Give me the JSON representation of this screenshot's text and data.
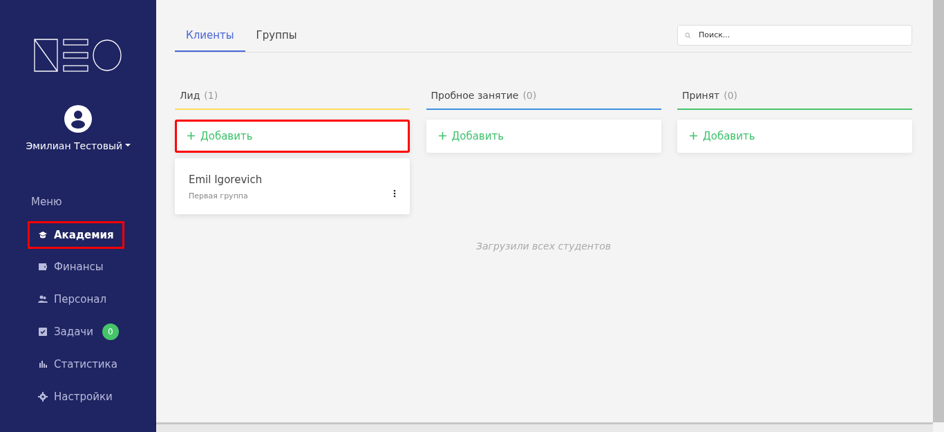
{
  "sidebar": {
    "user": {
      "name": "Эмилиан Тестовый"
    },
    "menu_title": "Меню",
    "items": [
      {
        "label": "Академия",
        "selected": true,
        "highlighted": true
      },
      {
        "label": "Финансы",
        "selected": false,
        "highlighted": false
      },
      {
        "label": "Персонал",
        "selected": false,
        "highlighted": false
      },
      {
        "label": "Задачи",
        "selected": false,
        "highlighted": false,
        "badge": "0"
      },
      {
        "label": "Статистика",
        "selected": false,
        "highlighted": false
      },
      {
        "label": "Настройки",
        "selected": false,
        "highlighted": false
      }
    ]
  },
  "tabs": [
    {
      "label": "Клиенты",
      "selected": true
    },
    {
      "label": "Группы",
      "selected": false
    }
  ],
  "search": {
    "placeholder": "Поиск..."
  },
  "columns": [
    {
      "title": "Лид",
      "count": "(1)",
      "color": "#fcdc5c",
      "add_label": "Добавить",
      "add_highlighted": true,
      "cards": [
        {
          "name": "Emil Igorevich",
          "group": "Первая группа"
        }
      ]
    },
    {
      "title": "Пробное занятие",
      "count": "(0)",
      "color": "#3d8fe0",
      "add_label": "Добавить",
      "add_highlighted": false
    },
    {
      "title": "Принят",
      "count": "(0)",
      "color": "#47c46b",
      "add_label": "Добавить",
      "add_highlighted": false
    }
  ],
  "footer_note": "Загрузили всех студентов"
}
